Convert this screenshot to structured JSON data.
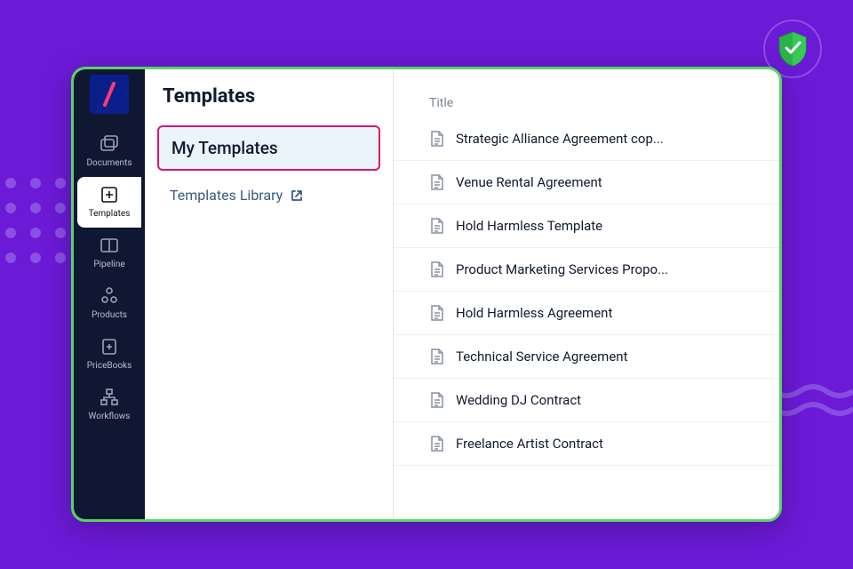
{
  "sidebar": {
    "items": [
      {
        "label": "Documents"
      },
      {
        "label": "Templates"
      },
      {
        "label": "Pipeline"
      },
      {
        "label": "Products"
      },
      {
        "label": "PriceBooks"
      },
      {
        "label": "Workflows"
      }
    ]
  },
  "panel": {
    "title": "Templates",
    "my_templates": "My Templates",
    "library": "Templates Library"
  },
  "table": {
    "header": "Title",
    "rows": [
      {
        "title": "Strategic Alliance Agreement cop..."
      },
      {
        "title": "Venue Rental Agreement"
      },
      {
        "title": "Hold Harmless Template"
      },
      {
        "title": "Product Marketing Services Propo..."
      },
      {
        "title": "Hold Harmless Agreement"
      },
      {
        "title": "Technical Service Agreement"
      },
      {
        "title": "Wedding DJ Contract"
      },
      {
        "title": "Freelance Artist Contract"
      }
    ]
  }
}
